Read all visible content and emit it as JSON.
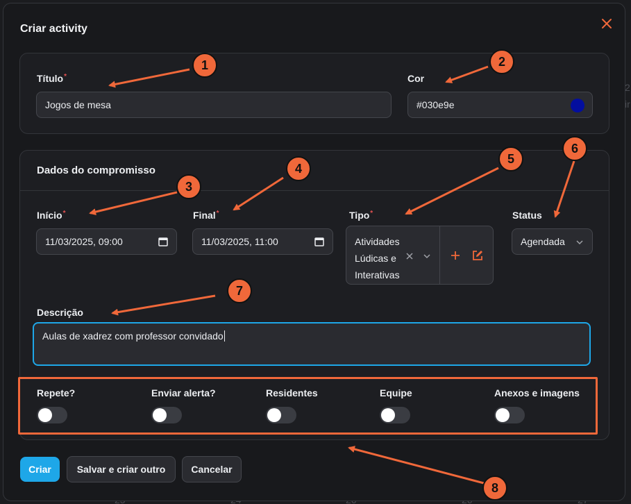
{
  "background": {
    "text": [
      "2",
      "ir",
      "25",
      "24",
      "26",
      "26",
      "27"
    ]
  },
  "modal": {
    "title": "Criar activity",
    "close_icon": "close-icon"
  },
  "section_basic": {
    "titulo_label": "Título",
    "titulo_value": "Jogos de mesa",
    "cor_label": "Cor",
    "cor_value": "#030e9e",
    "cor_swatch_color": "#030e9e"
  },
  "section_compromisso": {
    "heading": "Dados do compromisso",
    "inicio_label": "Início",
    "inicio_value": "11/03/2025, 09:00",
    "final_label": "Final",
    "final_value": "11/03/2025, 11:00",
    "tipo_label": "Tipo",
    "tipo_value": "Atividades Lúdicas e Interativas",
    "status_label": "Status",
    "status_value": "Agendada",
    "descricao_label": "Descrição",
    "descricao_value": "Aulas de xadrez com professor convidado"
  },
  "toggles": [
    {
      "label": "Repete?",
      "on": false
    },
    {
      "label": "Enviar alerta?",
      "on": false
    },
    {
      "label": "Residentes",
      "on": false
    },
    {
      "label": "Equipe",
      "on": false
    },
    {
      "label": "Anexos e imagens",
      "on": false
    }
  ],
  "buttons": {
    "criar": "Criar",
    "salvar_e_criar_outro": "Salvar e criar outro",
    "cancelar": "Cancelar"
  },
  "annotations": [
    "1",
    "2",
    "3",
    "4",
    "5",
    "6",
    "7",
    "8"
  ],
  "colors": {
    "accent": "#1ea7e8",
    "annotation": "#f0683a",
    "required": "#e55252"
  }
}
